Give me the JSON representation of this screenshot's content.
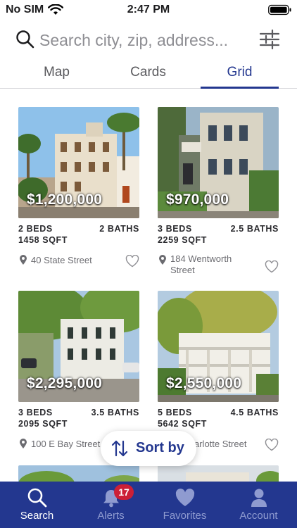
{
  "status_bar": {
    "carrier": "No SIM",
    "time": "2:47 PM"
  },
  "search": {
    "placeholder": "Search city, zip, address..."
  },
  "view_tabs": [
    {
      "label": "Map",
      "active": false
    },
    {
      "label": "Cards",
      "active": false
    },
    {
      "label": "Grid",
      "active": true
    }
  ],
  "listings": [
    {
      "price": "$1,200,000",
      "beds": "2 BEDS",
      "baths": "2 BATHS",
      "sqft": "1458 SQFT",
      "address": "40 State Street",
      "favorited": false
    },
    {
      "price": "$970,000",
      "beds": "3 BEDS",
      "baths": "2.5 BATHS",
      "sqft": "2259 SQFT",
      "address": "184 Wentworth Street",
      "favorited": false
    },
    {
      "price": "$2,295,000",
      "beds": "3 BEDS",
      "baths": "3.5 BATHS",
      "sqft": "2095 SQFT",
      "address": "100 E Bay Street",
      "favorited": false
    },
    {
      "price": "$2,550,000",
      "beds": "5 BEDS",
      "baths": "4.5 BATHS",
      "sqft": "5642 SQFT",
      "address": "arlotte Street",
      "favorited": false
    }
  ],
  "sort": {
    "label": "Sort by"
  },
  "tab_bar": [
    {
      "label": "Search",
      "icon": "search-icon",
      "active": true
    },
    {
      "label": "Alerts",
      "icon": "bell-icon",
      "active": false,
      "badge": "17"
    },
    {
      "label": "Favorites",
      "icon": "heart-icon",
      "active": false
    },
    {
      "label": "Account",
      "icon": "person-icon",
      "active": false
    }
  ],
  "colors": {
    "brand": "#23378f",
    "badge": "#cc1f36",
    "inactive_tab_label": "#8f9bd0"
  }
}
